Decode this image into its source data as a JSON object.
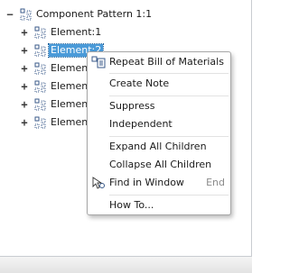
{
  "tree": {
    "root": {
      "expander": "−",
      "label": "Component Pattern 1:1"
    },
    "items": [
      {
        "expander": "+",
        "label": "Element:1"
      },
      {
        "expander": "+",
        "label": "Element:2"
      },
      {
        "expander": "+",
        "label": "Element:"
      },
      {
        "expander": "+",
        "label": "Element:"
      },
      {
        "expander": "+",
        "label": "Element:"
      },
      {
        "expander": "+",
        "label": "Element:"
      }
    ]
  },
  "context_menu": {
    "items": [
      {
        "label": "Repeat Bill of Materials",
        "icon": "repeat-bom-icon"
      },
      {
        "label": "Create Note"
      },
      {
        "label": "Suppress"
      },
      {
        "label": "Independent"
      },
      {
        "label": "Expand All Children"
      },
      {
        "label": "Collapse All Children"
      },
      {
        "label": "Find in Window",
        "shortcut": "End",
        "icon": "find-in-window-icon"
      },
      {
        "label": "How To..."
      }
    ]
  },
  "colors": {
    "selection": "#4a9ad8",
    "menu_border": "#a7a7a7",
    "shortcut": "#8a8a8a"
  }
}
